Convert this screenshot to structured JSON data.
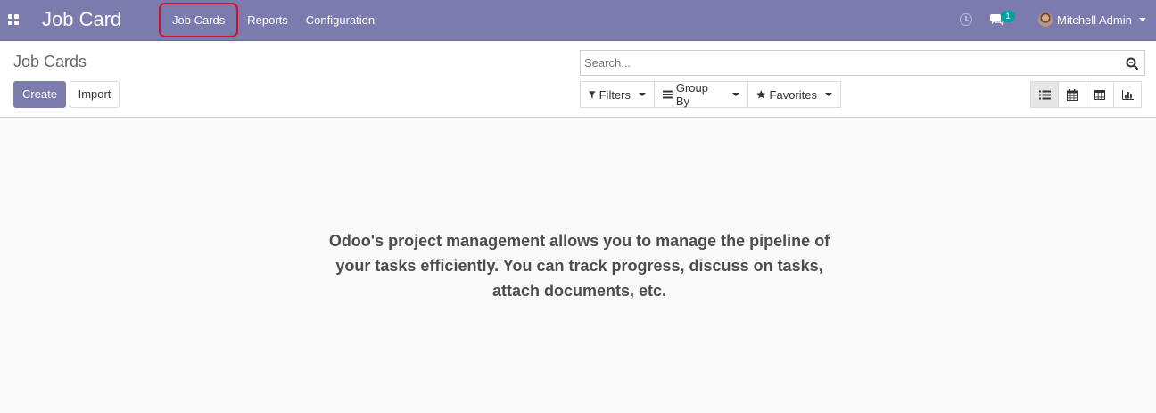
{
  "navbar": {
    "app_title": "Job Card",
    "menu": [
      {
        "label": "Job Cards"
      },
      {
        "label": "Reports"
      },
      {
        "label": "Configuration"
      }
    ],
    "message_count": "1",
    "user_name": "Mitchell Admin",
    "icons": [
      "apps-grid-icon",
      "clock-icon",
      "chat-icon",
      "avatar"
    ]
  },
  "control_panel": {
    "breadcrumb": "Job Cards",
    "create_label": "Create",
    "import_label": "Import",
    "search_placeholder": "Search...",
    "filters_label": "Filters",
    "group_by_label": "Group By",
    "favorites_label": "Favorites",
    "views": [
      "list-view",
      "calendar-view",
      "pivot-view",
      "graph-view"
    ],
    "active_view": "list-view"
  },
  "help_text": "Odoo's project management allows you to manage the pipeline of your tasks efficiently. You can track progress, discuss on tasks, attach documents, etc.",
  "colors": {
    "brand": "#7c7bad",
    "badge": "#00a09d",
    "highlight_border": "#d0102a"
  }
}
